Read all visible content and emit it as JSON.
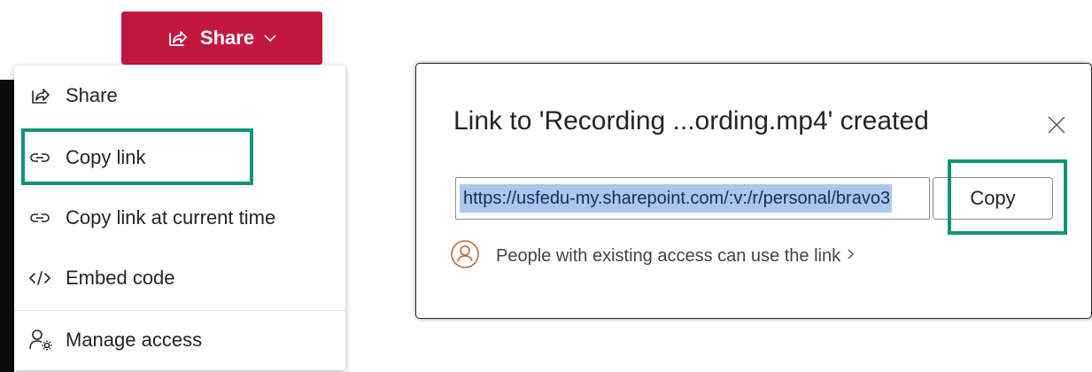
{
  "share_button": {
    "label": "Share",
    "color": "#c4173f"
  },
  "menu": {
    "items": [
      {
        "label": "Share",
        "icon": "share-icon"
      },
      {
        "label": "Copy link",
        "icon": "link-icon"
      },
      {
        "label": "Copy link at current time",
        "icon": "link-icon"
      },
      {
        "label": "Embed code",
        "icon": "embed-code-icon"
      },
      {
        "label": "Manage access",
        "icon": "manage-access-icon"
      }
    ]
  },
  "dialog": {
    "title": "Link to 'Recording ...ording.mp4' created",
    "link_value": "https://usfedu-my.sharepoint.com/:v:/r/personal/bravo3",
    "copy_label": "Copy",
    "access_text": "People with existing access can use the link"
  },
  "highlight_color": "#12927b"
}
